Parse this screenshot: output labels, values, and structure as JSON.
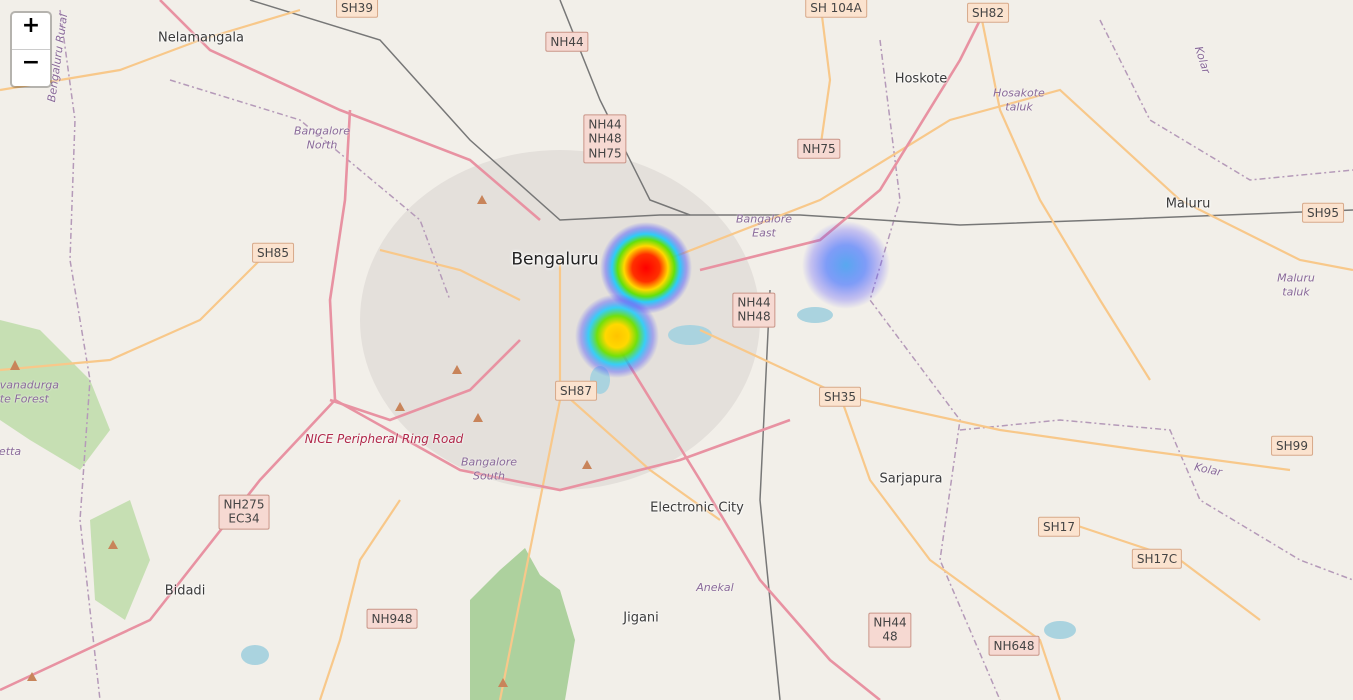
{
  "map": {
    "zoom_controls": {
      "zoom_in": "+",
      "zoom_out": "−"
    },
    "places": {
      "bengaluru": "Bengaluru",
      "nelamangala": "Nelamangala",
      "hoskote": "Hoskote",
      "maluru": "Maluru",
      "sarjapura": "Sarjapura",
      "electronic_city": "Electronic City",
      "jigani": "Jigani",
      "bidadi": "Bidadi"
    },
    "admin_areas": {
      "bangalore_north": "Bangalore\nNorth",
      "bangalore_east": "Bangalore\nEast",
      "bangalore_south": "Bangalore\nSouth",
      "hosakote_taluk": "Hosakote\ntaluk",
      "maluru_taluk": "Maluru\ntaluk",
      "anekal": "Anekal",
      "kolar_1": "Kolar",
      "kolar_2": "Kolar",
      "bengaluru_rural": "Bengaluru Rural",
      "forest": "avanadurga\nate Forest",
      "etta": "etta"
    },
    "road_label": "NICE Peripheral Ring Road",
    "shields": {
      "sh39": "SH39",
      "nh44_top": "NH44",
      "sh104a": "SH 104A",
      "sh82": "SH82",
      "nh44_48_75": "NH44\nNH48\nNH75",
      "nh75": "NH75",
      "sh85": "SH85",
      "sh95": "SH95",
      "nh44_48": "NH44\nNH48",
      "sh87": "SH87",
      "sh35": "SH35",
      "sh99": "SH99",
      "nh275": "NH275\nEC34",
      "sh17": "SH17",
      "sh17c": "SH17C",
      "nh948": "NH948",
      "nh44_48b": "NH44\n48",
      "nh648": "NH648"
    },
    "heat_points": [
      {
        "name": "central-hotspot",
        "intensity": 1.0
      },
      {
        "name": "south-hotspot",
        "intensity": 0.8
      },
      {
        "name": "east-hotspot",
        "intensity": 0.35
      }
    ],
    "colors": {
      "land": "#f2efe9",
      "major_road": "#e892a2",
      "secondary_road": "#f8c88a",
      "water": "#aad3df",
      "forest": "#add19e",
      "boundary": "#b59ab9",
      "heat_low": "#4060ff",
      "heat_high": "#ff0000"
    }
  }
}
